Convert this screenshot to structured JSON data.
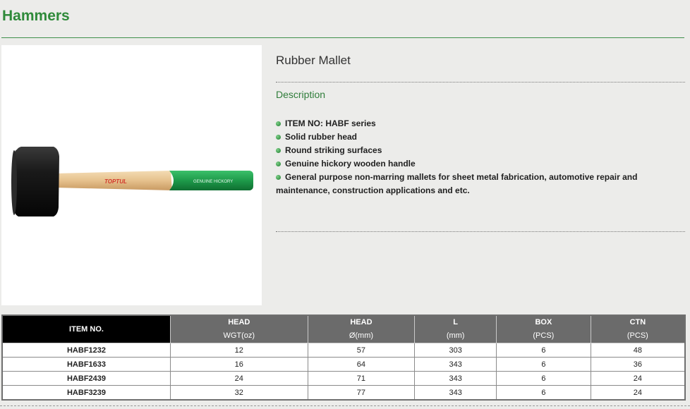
{
  "header": {
    "title": "Hammers"
  },
  "product": {
    "name": "Rubber Mallet",
    "image": {
      "brand_text": "TOPTUL",
      "handle_text": "GENUINE HICKORY",
      "colors": {
        "head": "#151515",
        "handle": "#e9c898",
        "grip": "#1e9a4a"
      }
    },
    "description_heading": "Description",
    "features": [
      "ITEM NO: HABF series",
      "Solid rubber head",
      "Round striking surfaces",
      "Genuine hickory wooden handle",
      "General purpose non-marring mallets for sheet metal fabrication, automotive repair and maintenance, construction applications and etc."
    ]
  },
  "table": {
    "headers": [
      {
        "line1": "ITEM NO.",
        "line2": ""
      },
      {
        "line1": "HEAD",
        "line2": "WGT(oz)"
      },
      {
        "line1": "HEAD",
        "line2": "Ø(mm)"
      },
      {
        "line1": "L",
        "line2": "(mm)"
      },
      {
        "line1": "BOX",
        "line2": "(PCS)"
      },
      {
        "line1": "CTN",
        "line2": "(PCS)"
      }
    ],
    "rows": [
      [
        "HABF1232",
        "12",
        "57",
        "303",
        "6",
        "48"
      ],
      [
        "HABF1633",
        "16",
        "64",
        "343",
        "6",
        "36"
      ],
      [
        "HABF2439",
        "24",
        "71",
        "343",
        "6",
        "24"
      ],
      [
        "HABF3239",
        "32",
        "77",
        "343",
        "6",
        "24"
      ]
    ]
  },
  "colors": {
    "accent": "#2f8a3a",
    "header_bg": "#6b6b6b",
    "first_header_bg": "#000000"
  }
}
